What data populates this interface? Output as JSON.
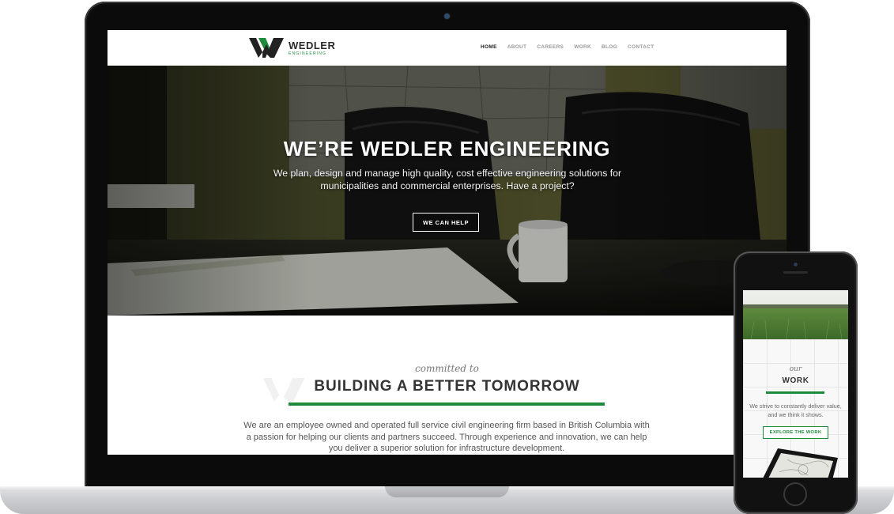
{
  "laptop": {
    "site": {
      "logo": {
        "name": "WEDLER",
        "sub": "ENGINEERING"
      },
      "nav": [
        {
          "label": "HOME",
          "active": true
        },
        {
          "label": "ABOUT"
        },
        {
          "label": "CAREERS"
        },
        {
          "label": "WORK"
        },
        {
          "label": "BLOG"
        },
        {
          "label": "CONTACT"
        }
      ],
      "hero": {
        "title": "WE’RE WEDLER ENGINEERING",
        "text": "We plan, design and manage high quality, cost effective engineering solutions for municipalities and commercial enterprises. Have a project?",
        "button": "WE CAN HELP"
      },
      "intro": {
        "kicker": "committed to",
        "title": "BUILDING A BETTER TOMORROW",
        "body": "We are an employee owned and operated full service civil engineering firm based in British Columbia with a passion for helping our clients and partners succeed. Through experience and innovation, we can help you deliver a superior solution for infrastructure development."
      }
    }
  },
  "phone": {
    "kicker": "our",
    "title": "WORK",
    "text": "We strive to constantly deliver value, and we think it shows.",
    "button": "EXPLORE THE WORK"
  },
  "colors": {
    "brand_green": "#1e8a3c",
    "dark": "#333333"
  }
}
